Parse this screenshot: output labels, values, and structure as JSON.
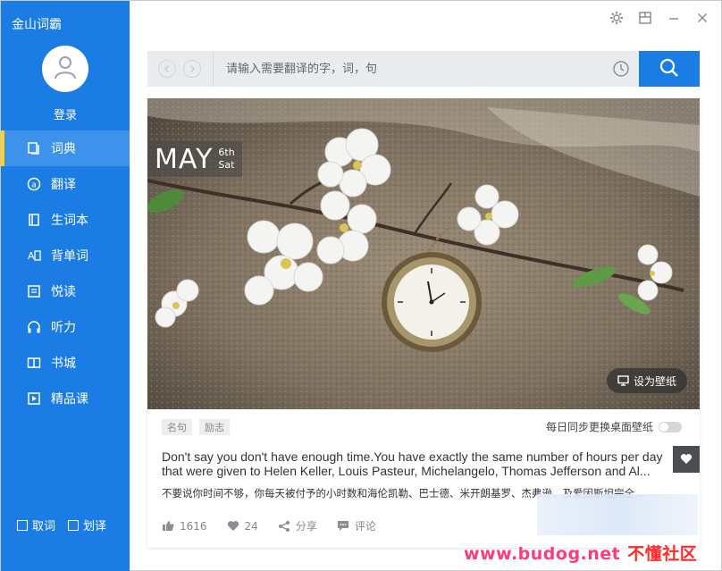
{
  "app": {
    "title": "金山词霸"
  },
  "user": {
    "login_label": "登录"
  },
  "sidebar": {
    "items": [
      {
        "label": "词典",
        "icon": "book-open-icon",
        "active": true
      },
      {
        "label": "翻译",
        "icon": "translate-icon",
        "active": false
      },
      {
        "label": "生词本",
        "icon": "notebook-icon",
        "active": false
      },
      {
        "label": "背单词",
        "icon": "flashcard-icon",
        "active": false
      },
      {
        "label": "悦读",
        "icon": "reading-icon",
        "active": false
      },
      {
        "label": "听力",
        "icon": "headphones-icon",
        "active": false
      },
      {
        "label": "书城",
        "icon": "bookstore-icon",
        "active": false
      },
      {
        "label": "精品课",
        "icon": "video-course-icon",
        "active": false
      }
    ],
    "options": [
      {
        "label": "取词"
      },
      {
        "label": "划译"
      }
    ]
  },
  "search": {
    "placeholder": "请输入需要翻译的字，词，句"
  },
  "daily": {
    "month": "MAY",
    "day": "6th",
    "weekday": "Sat",
    "wallpaper_label": "设为壁纸",
    "tags": [
      "名句",
      "励志"
    ],
    "sync_label": "每日同步更换桌面壁纸",
    "quote_en": "Don't say you don't have enough time.You have exactly the same number of hours per day that were given to Helen Keller, Louis Pasteur, Michelangelo, Thomas Jefferson and Al...",
    "quote_cn": "不要说你时间不够，你每天被付予的小时数和海伦凯勒、巴士德、米开朗基罗、杰弗逊、及爱因斯坦完全...",
    "likes": "1616",
    "hearts": "24",
    "share_label": "分享",
    "comment_label": "评论"
  },
  "watermark": {
    "url": "www.budog.net",
    "name": "不懂社区"
  },
  "colors": {
    "brand": "#1b7ce3",
    "active_indicator": "#ffd21f"
  }
}
